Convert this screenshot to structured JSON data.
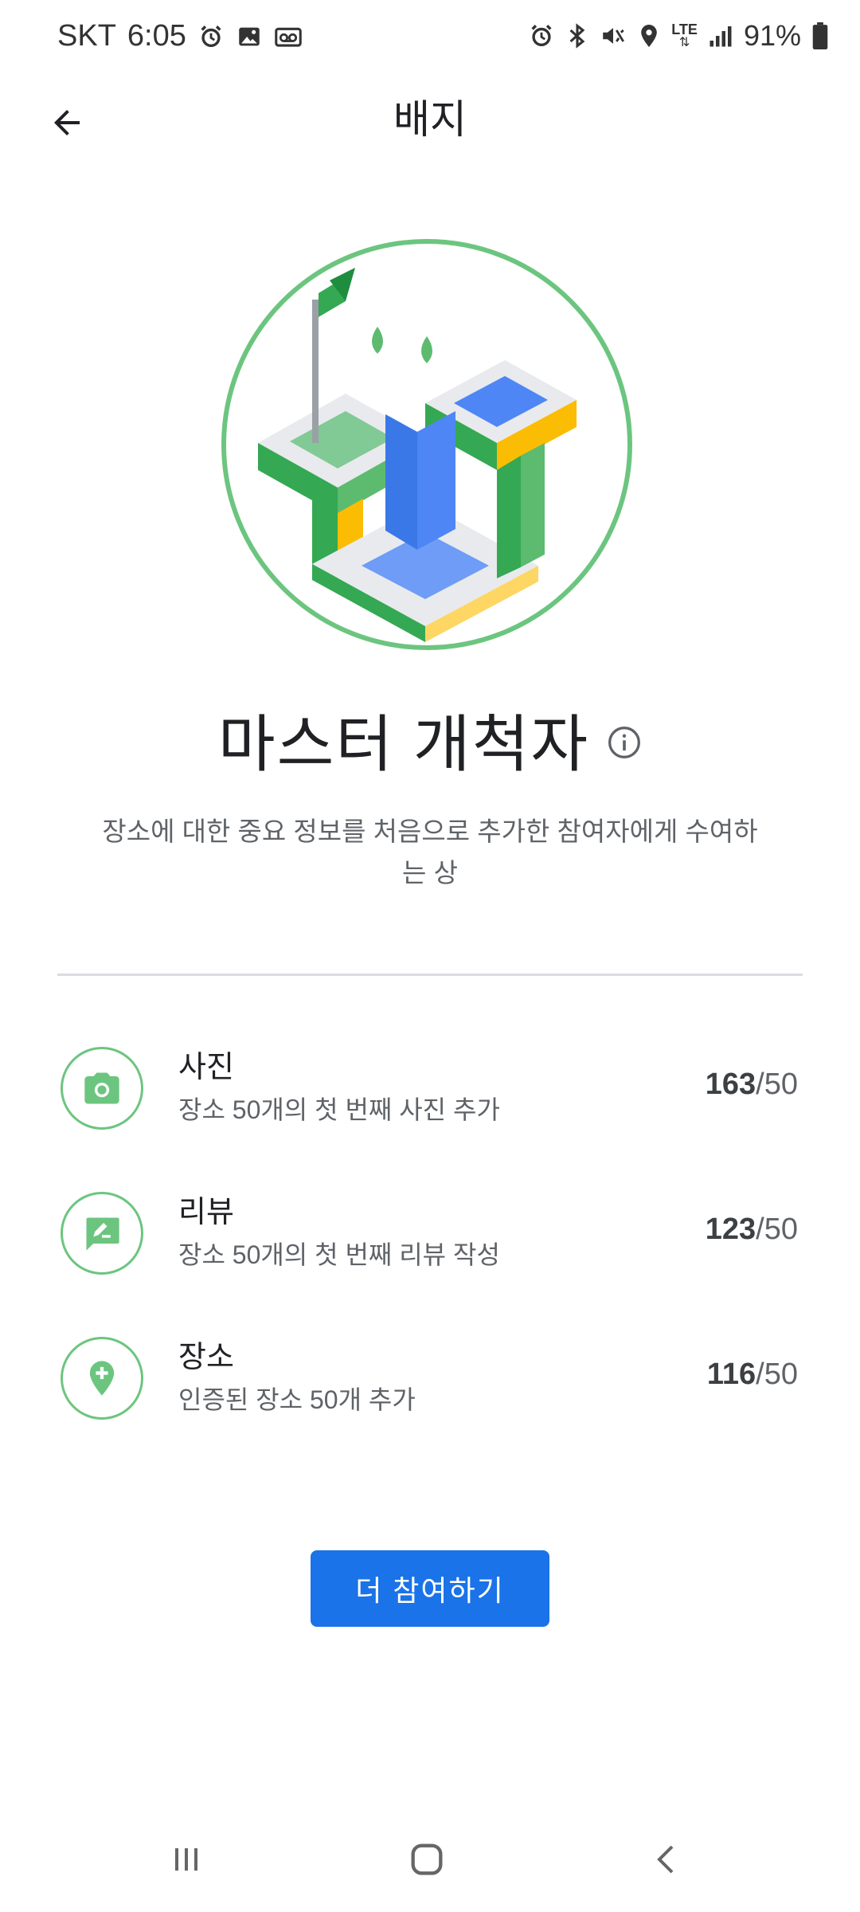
{
  "status_bar": {
    "carrier": "SKT",
    "time": "6:05",
    "network": "LTE",
    "battery": "91%",
    "left_icons": [
      "alarm-icon",
      "image-icon",
      "voicemail-icon"
    ],
    "right_icons": [
      "alarm-icon",
      "bluetooth-icon",
      "mute-icon",
      "location-icon",
      "lte-icon",
      "signal-icon",
      "battery-icon"
    ]
  },
  "header": {
    "title": "배지",
    "back_icon": "arrow-back-icon"
  },
  "badge": {
    "name": "마스터 개척자",
    "description": "장소에 대한 중요 정보를 처음으로 추가한 참여자에게 수여하는 상",
    "info_icon": "info-icon"
  },
  "criteria": [
    {
      "icon": "camera-icon",
      "title": "사진",
      "description": "장소 50개의 첫 번째 사진 추가",
      "current": "163",
      "target": "/50"
    },
    {
      "icon": "review-icon",
      "title": "리뷰",
      "description": "장소 50개의 첫 번째 리뷰 작성",
      "current": "123",
      "target": "/50"
    },
    {
      "icon": "add-place-icon",
      "title": "장소",
      "description": "인증된 장소 50개 추가",
      "current": "116",
      "target": "/50"
    }
  ],
  "actions": {
    "contribute_label": "더 참여하기"
  },
  "navigation_bar": [
    "recents-icon",
    "home-icon",
    "back-icon"
  ],
  "colors": {
    "accent_green": "#6cc57f",
    "primary_blue": "#1a73e8"
  }
}
